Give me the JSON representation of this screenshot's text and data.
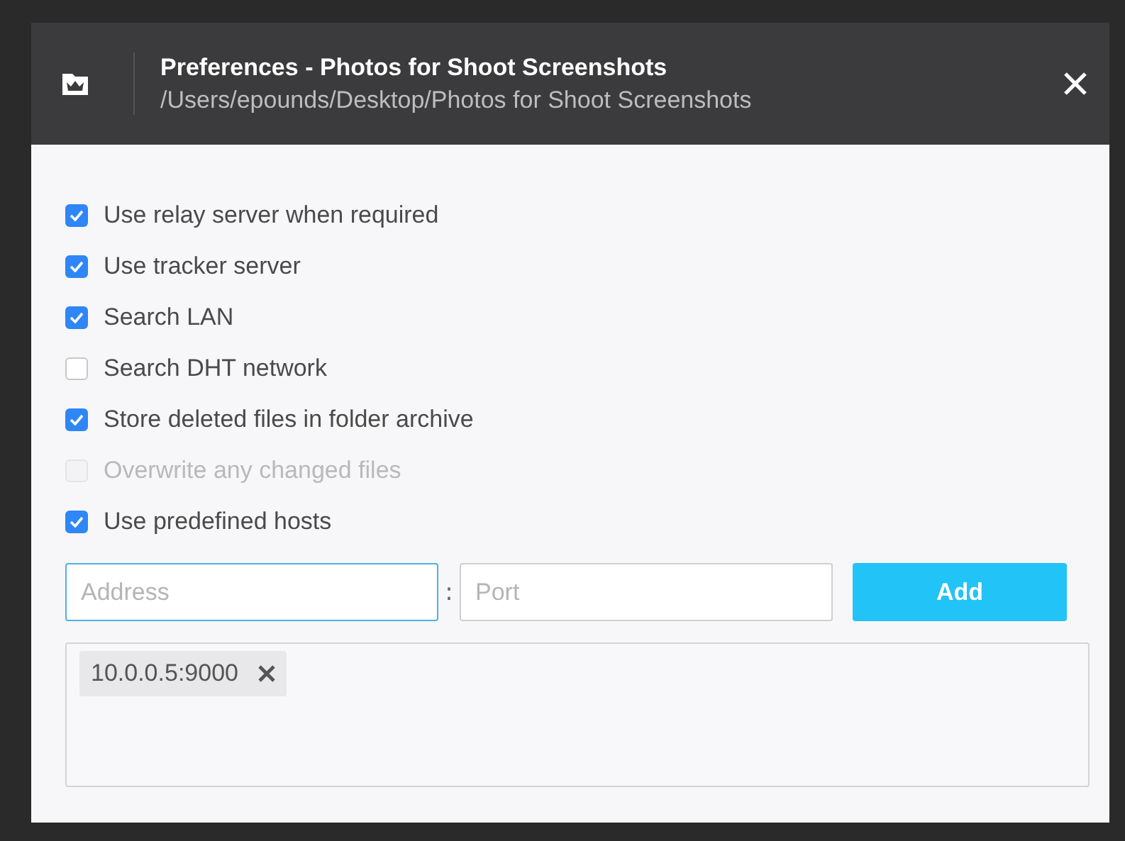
{
  "window": {
    "title": "Preferences - Photos for Shoot Screenshots",
    "path": "/Users/epounds/Desktop/Photos for Shoot Screenshots"
  },
  "options": [
    {
      "label": "Use relay server when required",
      "checked": true,
      "disabled": false
    },
    {
      "label": "Use tracker server",
      "checked": true,
      "disabled": false
    },
    {
      "label": "Search LAN",
      "checked": true,
      "disabled": false
    },
    {
      "label": "Search DHT network",
      "checked": false,
      "disabled": false
    },
    {
      "label": "Store deleted files in folder archive",
      "checked": true,
      "disabled": false
    },
    {
      "label": "Overwrite any changed files",
      "checked": false,
      "disabled": true
    },
    {
      "label": "Use predefined hosts",
      "checked": true,
      "disabled": false
    }
  ],
  "host_entry": {
    "address": {
      "placeholder": "Address",
      "focused": true
    },
    "separator": ":",
    "port": {
      "placeholder": "Port",
      "focused": false
    },
    "button": "Add"
  },
  "hosts": [
    "10.0.0.5:9000"
  ]
}
